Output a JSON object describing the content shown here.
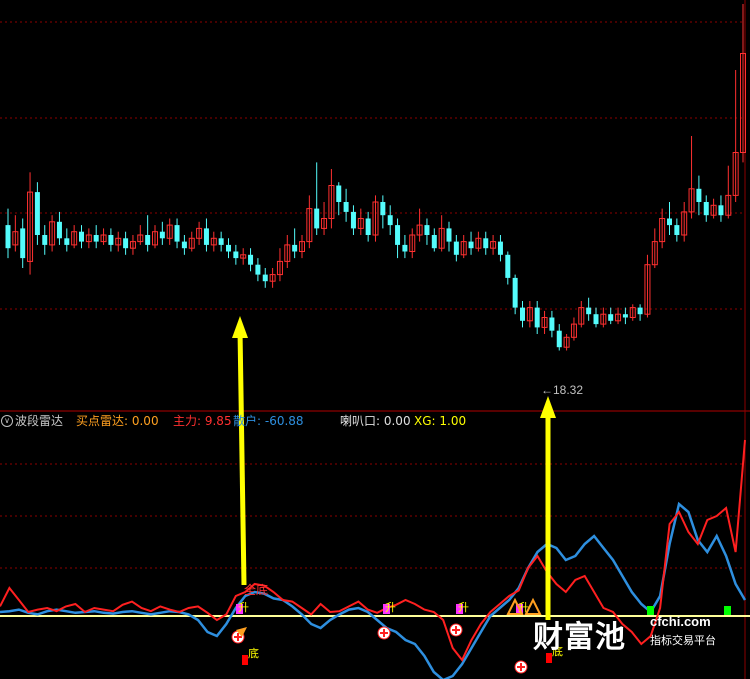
{
  "header": {
    "indicator_name": "波段雷达",
    "buy_label": "买点雷达: 0.00",
    "main_force_label": "主力: 9.85",
    "retail_label": "散户: -60.88",
    "horn_label": "喇叭口: 0.00",
    "xg_label": "XG: 1.00"
  },
  "price_annotation": "←18.32",
  "signal_labels": {
    "full_bottom": "全底",
    "rise": "升",
    "bottom": "底"
  },
  "watermark": {
    "brand": "财富池",
    "url": "cfchi.com",
    "tagline": "指标交易平台"
  },
  "colors": {
    "up": "#ff3030",
    "down": "#54fcfc",
    "grid": "#8b0000",
    "main_line": "#ff2020",
    "retail_line": "#2e8fdf",
    "arrow": "#ffff00",
    "baseline": "#ffff99"
  },
  "chart_data": [
    {
      "type": "candlestick",
      "title": "",
      "price_label_low": 18.32,
      "candles": [
        [
          0.53,
          0.46,
          0.58,
          0.43
        ],
        [
          0.47,
          0.51,
          0.56,
          0.45
        ],
        [
          0.52,
          0.43,
          0.55,
          0.4
        ],
        [
          0.42,
          0.63,
          0.69,
          0.38
        ],
        [
          0.63,
          0.5,
          0.66,
          0.47
        ],
        [
          0.5,
          0.47,
          0.53,
          0.44
        ],
        [
          0.47,
          0.54,
          0.56,
          0.45
        ],
        [
          0.54,
          0.49,
          0.57,
          0.47
        ],
        [
          0.49,
          0.47,
          0.52,
          0.45
        ],
        [
          0.47,
          0.51,
          0.53,
          0.46
        ],
        [
          0.51,
          0.48,
          0.53,
          0.46
        ],
        [
          0.48,
          0.5,
          0.52,
          0.46
        ],
        [
          0.5,
          0.48,
          0.53,
          0.46
        ],
        [
          0.48,
          0.5,
          0.52,
          0.47
        ],
        [
          0.5,
          0.47,
          0.52,
          0.45
        ],
        [
          0.47,
          0.49,
          0.51,
          0.45
        ],
        [
          0.49,
          0.46,
          0.51,
          0.44
        ],
        [
          0.46,
          0.48,
          0.5,
          0.44
        ],
        [
          0.48,
          0.5,
          0.53,
          0.47
        ],
        [
          0.5,
          0.47,
          0.56,
          0.45
        ],
        [
          0.47,
          0.51,
          0.53,
          0.46
        ],
        [
          0.51,
          0.49,
          0.54,
          0.47
        ],
        [
          0.49,
          0.53,
          0.55,
          0.47
        ],
        [
          0.53,
          0.48,
          0.55,
          0.46
        ],
        [
          0.48,
          0.46,
          0.5,
          0.44
        ],
        [
          0.46,
          0.49,
          0.51,
          0.45
        ],
        [
          0.49,
          0.52,
          0.54,
          0.47
        ],
        [
          0.52,
          0.47,
          0.55,
          0.45
        ],
        [
          0.47,
          0.49,
          0.51,
          0.45
        ],
        [
          0.49,
          0.47,
          0.51,
          0.45
        ],
        [
          0.47,
          0.45,
          0.49,
          0.43
        ],
        [
          0.45,
          0.43,
          0.47,
          0.41
        ],
        [
          0.43,
          0.44,
          0.46,
          0.41
        ],
        [
          0.44,
          0.41,
          0.46,
          0.39
        ],
        [
          0.41,
          0.38,
          0.43,
          0.36
        ],
        [
          0.38,
          0.36,
          0.4,
          0.34
        ],
        [
          0.36,
          0.38,
          0.4,
          0.34
        ],
        [
          0.38,
          0.42,
          0.46,
          0.36
        ],
        [
          0.42,
          0.47,
          0.5,
          0.4
        ],
        [
          0.47,
          0.45,
          0.52,
          0.43
        ],
        [
          0.45,
          0.48,
          0.5,
          0.43
        ],
        [
          0.48,
          0.58,
          0.62,
          0.46
        ],
        [
          0.58,
          0.52,
          0.72,
          0.5
        ],
        [
          0.52,
          0.55,
          0.6,
          0.5
        ],
        [
          0.55,
          0.65,
          0.7,
          0.52
        ],
        [
          0.65,
          0.6,
          0.66,
          0.56
        ],
        [
          0.6,
          0.57,
          0.64,
          0.54
        ],
        [
          0.57,
          0.52,
          0.59,
          0.5
        ],
        [
          0.52,
          0.55,
          0.58,
          0.5
        ],
        [
          0.55,
          0.5,
          0.57,
          0.48
        ],
        [
          0.5,
          0.6,
          0.62,
          0.48
        ],
        [
          0.6,
          0.56,
          0.62,
          0.52
        ],
        [
          0.56,
          0.53,
          0.59,
          0.5
        ],
        [
          0.53,
          0.47,
          0.55,
          0.43
        ],
        [
          0.47,
          0.45,
          0.5,
          0.43
        ],
        [
          0.45,
          0.5,
          0.52,
          0.43
        ],
        [
          0.5,
          0.53,
          0.58,
          0.48
        ],
        [
          0.53,
          0.5,
          0.55,
          0.47
        ],
        [
          0.5,
          0.46,
          0.52,
          0.45
        ],
        [
          0.46,
          0.52,
          0.56,
          0.45
        ],
        [
          0.52,
          0.48,
          0.54,
          0.45
        ],
        [
          0.48,
          0.44,
          0.5,
          0.42
        ],
        [
          0.44,
          0.48,
          0.5,
          0.43
        ],
        [
          0.48,
          0.46,
          0.51,
          0.44
        ],
        [
          0.46,
          0.49,
          0.51,
          0.45
        ],
        [
          0.49,
          0.46,
          0.51,
          0.44
        ],
        [
          0.46,
          0.48,
          0.5,
          0.44
        ],
        [
          0.48,
          0.44,
          0.5,
          0.42
        ],
        [
          0.44,
          0.37,
          0.45,
          0.35
        ],
        [
          0.37,
          0.28,
          0.38,
          0.26
        ],
        [
          0.28,
          0.24,
          0.3,
          0.22
        ],
        [
          0.24,
          0.28,
          0.3,
          0.22
        ],
        [
          0.28,
          0.22,
          0.3,
          0.2
        ],
        [
          0.22,
          0.25,
          0.27,
          0.2
        ],
        [
          0.25,
          0.21,
          0.27,
          0.19
        ],
        [
          0.21,
          0.16,
          0.23,
          0.15
        ],
        [
          0.16,
          0.19,
          0.2,
          0.15
        ],
        [
          0.19,
          0.23,
          0.25,
          0.18
        ],
        [
          0.23,
          0.28,
          0.3,
          0.22
        ],
        [
          0.28,
          0.26,
          0.31,
          0.24
        ],
        [
          0.26,
          0.23,
          0.28,
          0.22
        ],
        [
          0.23,
          0.26,
          0.28,
          0.22
        ],
        [
          0.26,
          0.24,
          0.28,
          0.23
        ],
        [
          0.24,
          0.26,
          0.28,
          0.23
        ],
        [
          0.26,
          0.25,
          0.28,
          0.23
        ],
        [
          0.25,
          0.28,
          0.29,
          0.24
        ],
        [
          0.28,
          0.26,
          0.29,
          0.24
        ],
        [
          0.26,
          0.41,
          0.44,
          0.25
        ],
        [
          0.41,
          0.48,
          0.52,
          0.4
        ],
        [
          0.48,
          0.55,
          0.58,
          0.46
        ],
        [
          0.55,
          0.53,
          0.6,
          0.5
        ],
        [
          0.53,
          0.5,
          0.55,
          0.48
        ],
        [
          0.5,
          0.57,
          0.6,
          0.48
        ],
        [
          0.57,
          0.64,
          0.8,
          0.55
        ],
        [
          0.64,
          0.6,
          0.68,
          0.56
        ],
        [
          0.6,
          0.56,
          0.62,
          0.54
        ],
        [
          0.56,
          0.59,
          0.61,
          0.55
        ],
        [
          0.59,
          0.56,
          0.62,
          0.54
        ],
        [
          0.56,
          0.62,
          0.71,
          0.55
        ],
        [
          0.62,
          0.75,
          1.0,
          0.6
        ],
        [
          0.75,
          1.05,
          1.2,
          0.72
        ]
      ]
    },
    {
      "type": "line",
      "title": "",
      "series": [
        {
          "name": "主力",
          "values": [
            0.12,
            0.35,
            0.2,
            0.05,
            0.08,
            0.1,
            0.06,
            0.12,
            0.15,
            0.05,
            0.1,
            0.08,
            0.06,
            0.14,
            0.18,
            0.1,
            0.06,
            0.12,
            0.08,
            0.05,
            0.1,
            0.12,
            0.04,
            -0.05,
            0.02,
            0.25,
            0.3,
            0.4,
            0.38,
            0.3,
            0.2,
            0.18,
            0.1,
            0.02,
            0.15,
            0.05,
            0.06,
            0.12,
            0.18,
            0.08,
            0.04,
            0.1,
            0.14,
            0.2,
            0.15,
            0.08,
            0.05,
            -0.05,
            -0.4,
            -0.55,
            -0.3,
            -0.1,
            0.05,
            0.15,
            0.25,
            0.32,
            0.6,
            0.75,
            0.55,
            0.4,
            0.3,
            0.45,
            0.5,
            0.3,
            0.1,
            0.05,
            -0.1,
            -0.2,
            -0.35,
            -0.25,
            0.1,
            1.15,
            1.3,
            1.05,
            0.9,
            1.2,
            1.25,
            1.35,
            0.8,
            2.2
          ]
        },
        {
          "name": "散户",
          "values": [
            0.05,
            0.06,
            0.08,
            0.04,
            0.02,
            0.06,
            0.08,
            0.06,
            0.04,
            0.05,
            0.06,
            0.04,
            0.03,
            0.05,
            0.06,
            0.04,
            0.02,
            0.04,
            0.06,
            0.05,
            0.02,
            -0.05,
            -0.2,
            -0.25,
            -0.1,
            0.1,
            0.25,
            0.3,
            0.28,
            0.22,
            0.2,
            0.12,
            0.02,
            -0.1,
            -0.15,
            -0.05,
            0.02,
            0.08,
            0.1,
            0.05,
            -0.05,
            -0.15,
            -0.2,
            -0.3,
            -0.35,
            -0.5,
            -0.7,
            -0.8,
            -0.75,
            -0.6,
            -0.4,
            -0.2,
            0.0,
            0.1,
            0.2,
            0.35,
            0.6,
            0.8,
            0.9,
            0.85,
            0.7,
            0.75,
            0.9,
            1.0,
            0.85,
            0.7,
            0.5,
            0.3,
            0.15,
            0.05,
            0.25,
            0.9,
            1.4,
            1.3,
            0.95,
            0.8,
            1.0,
            0.75,
            0.4,
            0.2
          ]
        }
      ]
    }
  ]
}
